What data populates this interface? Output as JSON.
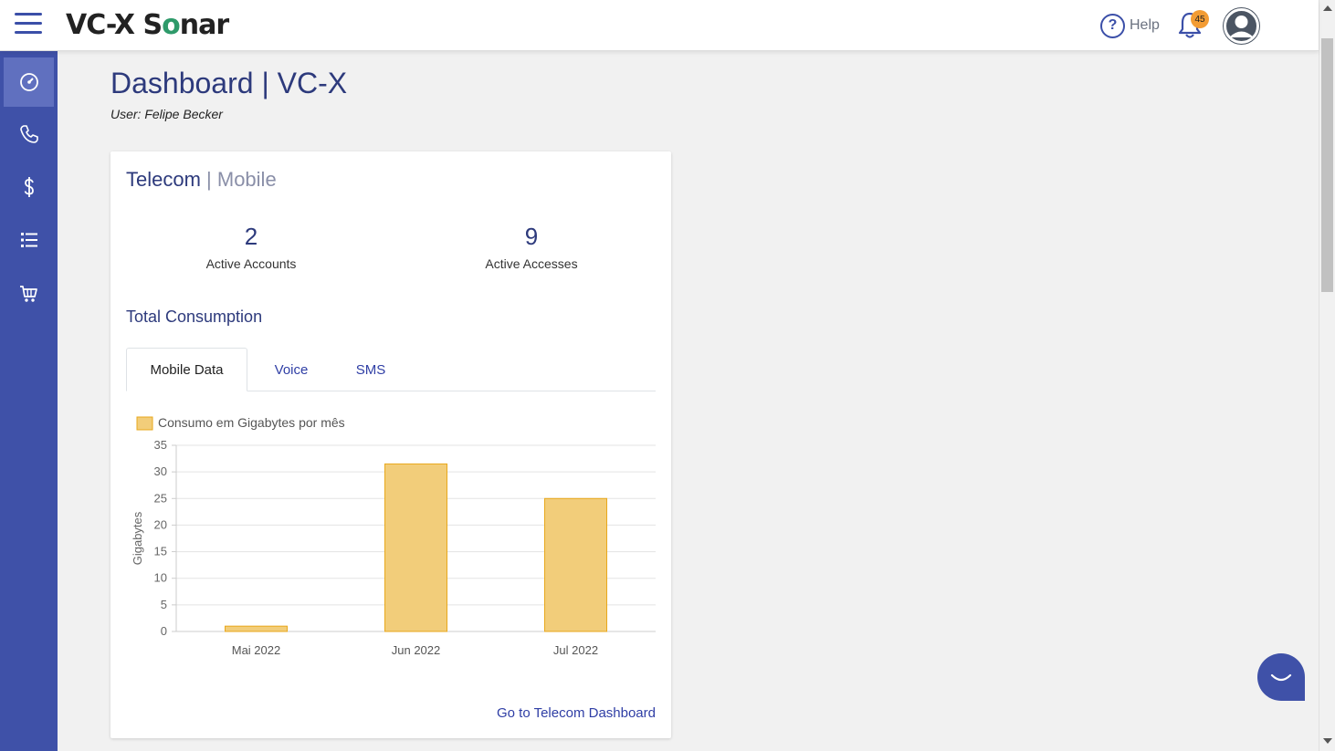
{
  "header": {
    "logo_text_a": "VC-X S",
    "logo_text_b": "o",
    "logo_text_c": "nar",
    "help_label": "Help",
    "notification_count": "45"
  },
  "sidebar": {
    "items": [
      {
        "icon": "dashboard-gauge-icon",
        "active": true
      },
      {
        "icon": "phone-icon",
        "active": false
      },
      {
        "icon": "dollar-icon",
        "active": false
      },
      {
        "icon": "list-icon",
        "active": false
      },
      {
        "icon": "cart-icon",
        "active": false
      }
    ]
  },
  "page": {
    "title": "Dashboard | VC-X",
    "user_line": "User: Felipe Becker"
  },
  "card": {
    "title": "Telecom",
    "title_sep": " | ",
    "subtitle": "Mobile",
    "stats": [
      {
        "value": "2",
        "label": "Active Accounts"
      },
      {
        "value": "9",
        "label": "Active Accesses"
      }
    ],
    "section_title": "Total Consumption",
    "tabs": [
      {
        "label": "Mobile Data",
        "active": true
      },
      {
        "label": "Voice",
        "active": false
      },
      {
        "label": "SMS",
        "active": false
      }
    ],
    "footer_link": "Go to Telecom Dashboard"
  },
  "chart_data": {
    "type": "bar",
    "categories": [
      "Mai 2022",
      "Jun 2022",
      "Jul 2022"
    ],
    "series": [
      {
        "name": "Consumo em Gigabytes por mês",
        "values": [
          1,
          31.5,
          25
        ]
      }
    ],
    "xlabel": "",
    "ylabel": "Gigabytes",
    "ylim": [
      0,
      35
    ],
    "yticks": [
      0,
      5,
      10,
      15,
      20,
      25,
      30,
      35
    ],
    "grid": true,
    "legend": "top-left",
    "bar_fill": "#f2cd7a",
    "bar_stroke": "#e8a81c"
  }
}
